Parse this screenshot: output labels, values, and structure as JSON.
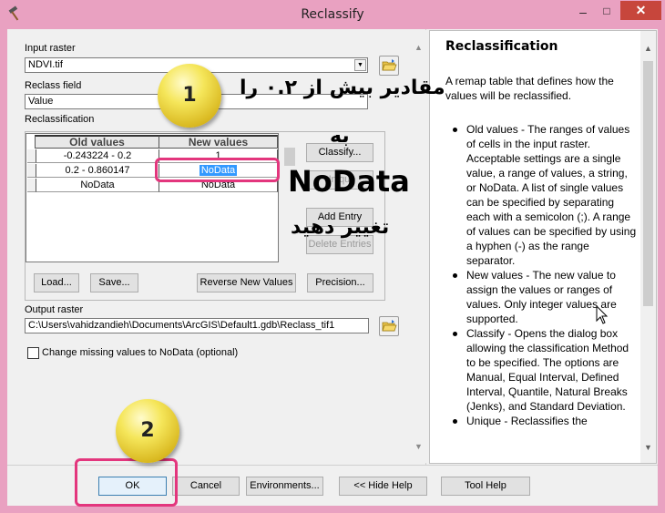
{
  "window": {
    "title": "Reclassify",
    "minimize_glyph": "–",
    "maximize_glyph": "□",
    "close_glyph": "✕"
  },
  "form": {
    "input_raster_label": "Input raster",
    "input_raster_value": "NDVI.tif",
    "reclass_field_label": "Reclass field",
    "reclass_field_value": "Value",
    "reclassification_label": "Reclassification",
    "output_raster_label": "Output raster",
    "output_raster_value": "C:\\Users\\vahidzandieh\\Documents\\ArcGIS\\Default1.gdb\\Reclass_tif1",
    "change_missing_label": "Change missing values to NoData (optional)",
    "change_missing_checked": false
  },
  "table": {
    "headers": [
      "Old values",
      "New values"
    ],
    "rows": [
      {
        "old": "-0.243224 - 0.2",
        "new": "1"
      },
      {
        "old": "0.2 - 0.860147",
        "new": "NoData"
      },
      {
        "old": "NoData",
        "new": "NoData"
      }
    ]
  },
  "buttons": {
    "classify": "Classify...",
    "unique": "Unique",
    "add_entry": "Add Entry",
    "delete_entries": "Delete Entries",
    "load": "Load...",
    "save": "Save...",
    "reverse_new_values": "Reverse New Values",
    "precision": "Precision...",
    "ok": "OK",
    "cancel": "Cancel",
    "environments": "Environments...",
    "hide_help": "<< Hide Help",
    "tool_help": "Tool Help"
  },
  "help": {
    "title": "Reclassification",
    "intro": "A remap table that defines how the values will be reclassified.",
    "bullets": [
      "Old values - The ranges of values of cells in the input raster. Acceptable settings are a single value, a range of values, a string, or NoData. A list of single values can be specified by separating each with a semicolon (;). A range of values can be specified by using a hyphen (-) as the range separator.",
      "New values - The new value to assign the values or ranges of values. Only integer values are supported.",
      "Classify - Opens the dialog box allowing the classification Method to be specified. The options are Manual, Equal Interval, Defined Interval, Quantile, Natural Breaks (Jenks), and Standard Deviation.",
      "Unique - Reclassifies the"
    ]
  },
  "annotations": {
    "badge1": "1",
    "badge2": "2",
    "line1": "مقادیر بیش از ۰.۲ را",
    "line2": "به",
    "line3": "NoData",
    "line4": "تغییر دهید"
  },
  "colors": {
    "title_bar": "#e9a1c1",
    "close_button": "#c7463c",
    "highlight_box": "#e3367d",
    "badge": "#f5e65a",
    "selection": "#3399ff"
  }
}
